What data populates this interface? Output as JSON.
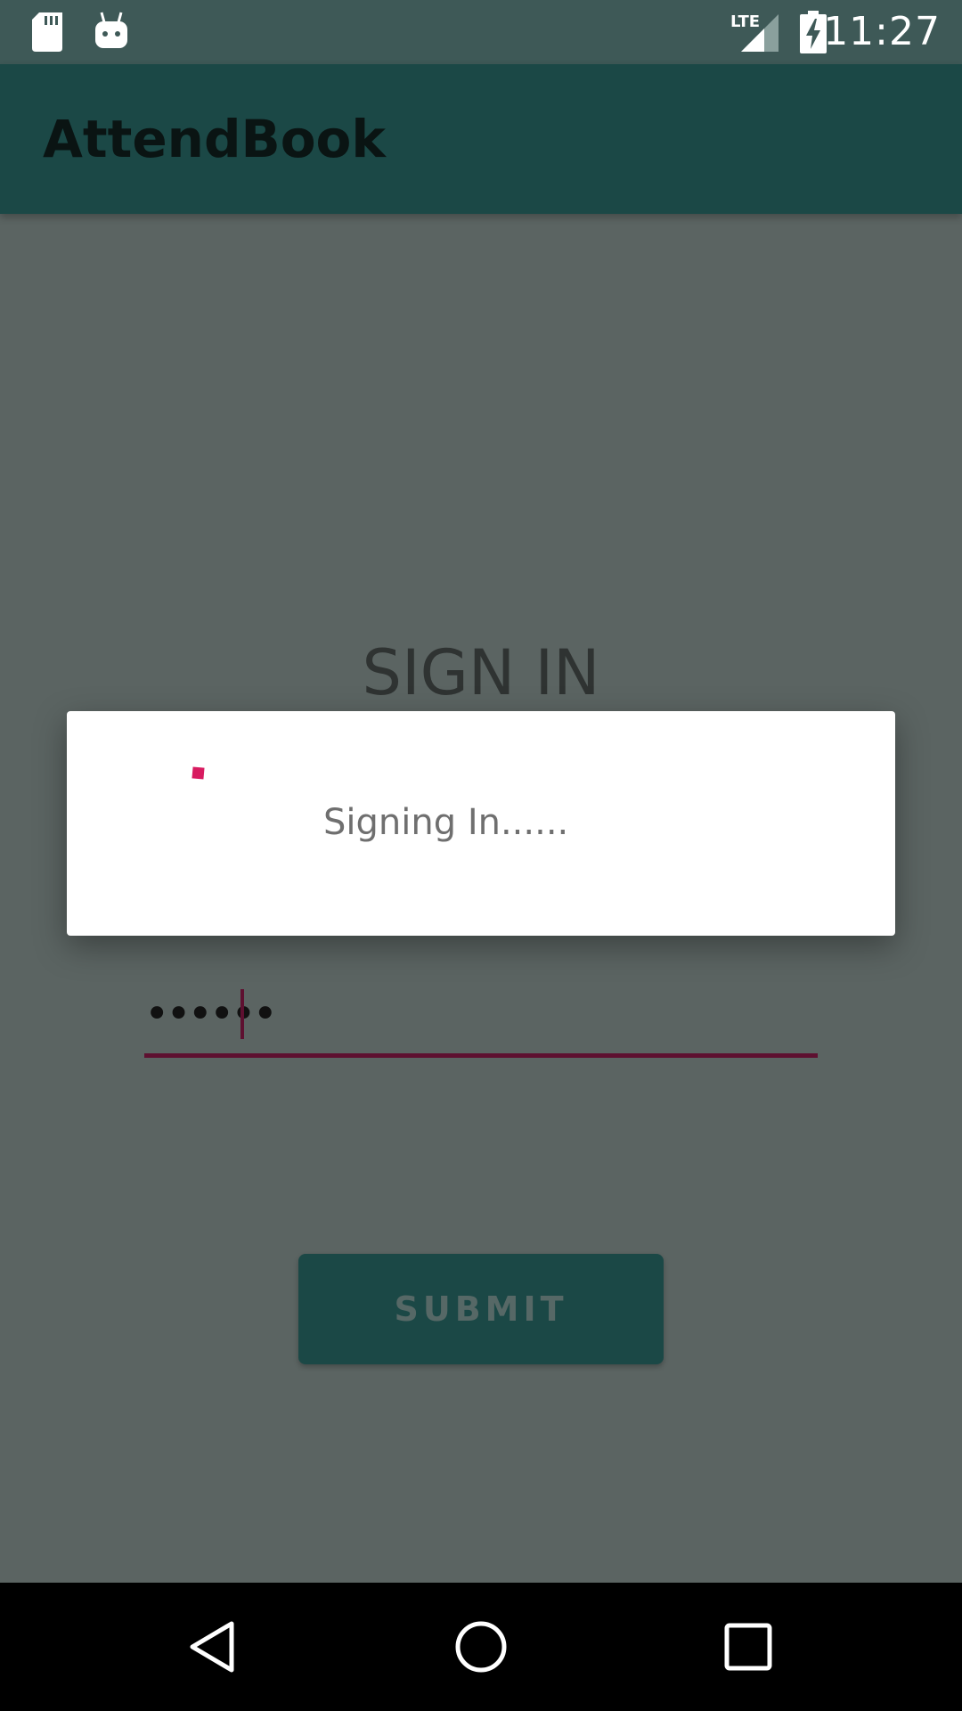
{
  "status_bar": {
    "time": "11:27",
    "icons": [
      "sd-card-icon",
      "android-debug-icon",
      "lte-signal-icon",
      "battery-charging-icon"
    ],
    "background": "#3e5957"
  },
  "app_bar": {
    "title": "AttendBook",
    "background": "#1b4846"
  },
  "form": {
    "heading": "SIGN IN",
    "password_value": "••••••",
    "submit_label": "SUBMIT",
    "accent": "#5e1030"
  },
  "dialog": {
    "message": "Signing In......",
    "progress_color": "#d81b60"
  },
  "nav_bar": {
    "icons": [
      "back-icon",
      "home-icon",
      "recents-icon"
    ]
  }
}
